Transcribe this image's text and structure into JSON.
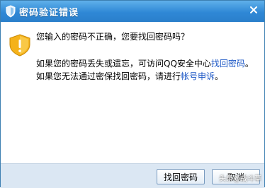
{
  "window": {
    "title": "密码验证错误"
  },
  "message": {
    "question": "您输入的密码不正确，您要找回密码吗？",
    "line1_prefix": "如果您的密码丢失或遗忘，可访问QQ安全中心",
    "line1_link": "找回密码",
    "line1_suffix": "。",
    "line2_prefix": "如果您无法通过密保找回密码，请进行",
    "line2_link": "帐号申诉",
    "line2_suffix": "。"
  },
  "buttons": {
    "recover_label": "找回密码",
    "cancel_label": "取消"
  },
  "watermark": "头条@战斗草",
  "icons": {
    "title": "qq-shield-icon",
    "warning": "warning-shield-icon",
    "close": "close-icon"
  },
  "colors": {
    "titlebar": "#2f88d6",
    "link": "#1b56c5",
    "footer": "#dbe7f3"
  }
}
